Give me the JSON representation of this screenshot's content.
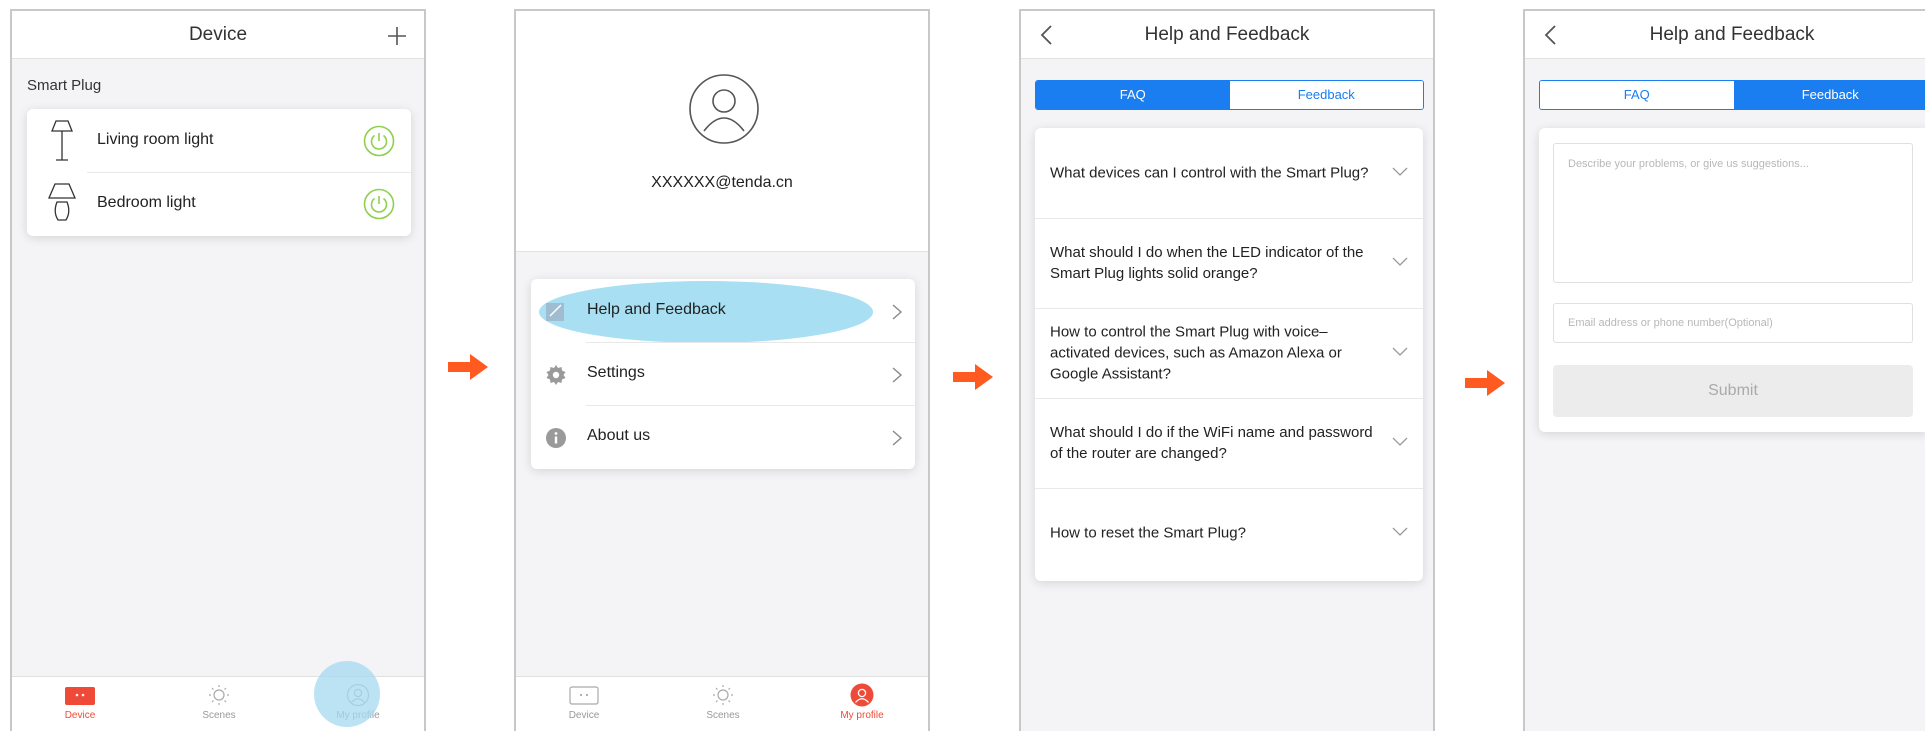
{
  "screen1": {
    "title": "Device",
    "section": "Smart Plug",
    "devices": [
      {
        "name": "Living room light",
        "icon": "floor-lamp-icon"
      },
      {
        "name": "Bedroom light",
        "icon": "table-lamp-icon"
      }
    ],
    "tabs": [
      "Device",
      "Scenes",
      "My profile"
    ],
    "active_tab": "Device"
  },
  "screen2": {
    "email": "XXXXXX@tenda.cn",
    "menu": [
      {
        "label": "Help and Feedback",
        "icon": "help-feedback-icon"
      },
      {
        "label": "Settings",
        "icon": "gear-icon"
      },
      {
        "label": "About us",
        "icon": "info-icon"
      }
    ],
    "tabs": [
      "Device",
      "Scenes",
      "My profile"
    ],
    "active_tab": "My profile"
  },
  "screen3": {
    "title": "Help and Feedback",
    "seg": {
      "faq": "FAQ",
      "feedback": "Feedback",
      "active": "FAQ"
    },
    "questions": [
      "What devices can I control with the Smart Plug?",
      "What should I do when the LED indicator of the Smart Plug lights solid orange?",
      "How to control the Smart Plug with voice–activated devices, such as Amazon Alexa or Google Assistant?",
      "What should I do if the WiFi name and password of the router are changed?",
      "How to reset the Smart Plug?"
    ]
  },
  "screen4": {
    "title": "Help and Feedback",
    "seg": {
      "faq": "FAQ",
      "feedback": "Feedback",
      "active": "Feedback"
    },
    "description_placeholder": "Describe your problems, or give us suggestions...",
    "contact_placeholder": "Email address or phone number(Optional)",
    "submit_label": "Submit"
  },
  "colors": {
    "accent": "#1a7ef0",
    "arrow": "#ff5a1f",
    "power": "#8fd14f",
    "active_tab": "#ef4a38",
    "highlight": "#a8dff3"
  }
}
